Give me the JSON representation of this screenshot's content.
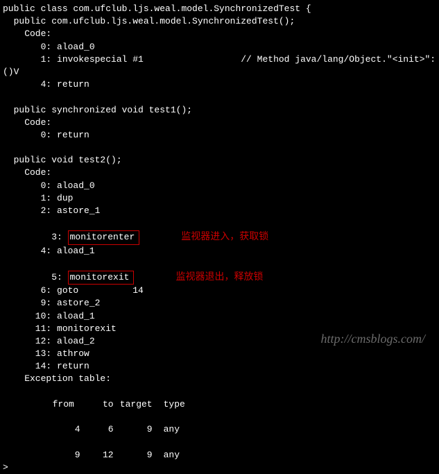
{
  "class_decl": "public class com.ufclub.ljs.weal.model.SynchronizedTest {",
  "constructor_decl": "  public com.ufclub.ljs.weal.model.SynchronizedTest();",
  "code_label": "    Code:",
  "constructor_instrs": [
    "       0: aload_0",
    "       1: invokespecial #1                  // Method java/lang/Object.\"<init>\":",
    "       4: return"
  ],
  "wrap_fragment": "()V",
  "method1_decl": "  public synchronized void test1();",
  "method1_instrs": [
    "       0: return"
  ],
  "method2_decl": "  public void test2();",
  "method2_instrs_top": [
    "       0: aload_0",
    "       1: dup",
    "       2: astore_1"
  ],
  "method2_monitorenter_num": "       3: ",
  "method2_monitorenter": "monitorenter",
  "method2_instr4": "       4: aload_1",
  "method2_monitorexit_num": "       5: ",
  "method2_monitorexit": "monitorexit",
  "method2_instrs_bottom": [
    "       6: goto          14",
    "       9: astore_2",
    "      10: aload_1",
    "      11: monitorexit",
    "      12: aload_2",
    "      13: athrow",
    "      14: return"
  ],
  "annotation1": "监视器进入，获取锁",
  "annotation2": "监视器退出，释放锁",
  "exception_table_label": "    Exception table:",
  "exception_header": {
    "from": "from",
    "to": "to",
    "target": "target",
    "type": "type"
  },
  "exception_rows": [
    {
      "from": "4",
      "to": "6",
      "target": "9",
      "type": "any"
    },
    {
      "from": "9",
      "to": "12",
      "target": "9",
      "type": "any"
    }
  ],
  "watermark": "http://cmsblogs.com/"
}
